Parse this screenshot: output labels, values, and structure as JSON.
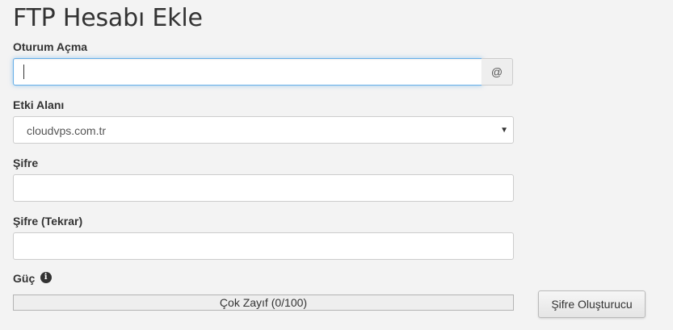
{
  "page": {
    "title": "FTP Hesabı Ekle"
  },
  "login": {
    "label": "Oturum Açma",
    "value": "",
    "addon": "@"
  },
  "domain": {
    "label": "Etki Alanı",
    "selected": "cloudvps.com.tr"
  },
  "password": {
    "label": "Şifre",
    "value": ""
  },
  "password_repeat": {
    "label": "Şifre (Tekrar)",
    "value": ""
  },
  "strength": {
    "label": "Güç",
    "info_icon": "info-circle-icon",
    "text": "Çok Zayıf (0/100)",
    "score": 0,
    "max": 100,
    "fill_color": "#d9534f"
  },
  "generator": {
    "button_label": "Şifre Oluşturucu"
  },
  "colors": {
    "focus_border": "#66afe9",
    "background": "#f3f3f3"
  }
}
